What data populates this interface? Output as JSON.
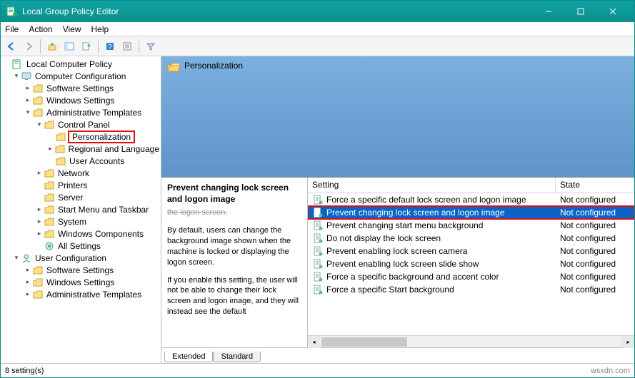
{
  "window": {
    "title": "Local Group Policy Editor"
  },
  "menubar": {
    "file": "File",
    "action": "Action",
    "view": "View",
    "help": "Help"
  },
  "tree": {
    "root": "Local Computer Policy",
    "cc": "Computer Configuration",
    "ss": "Software Settings",
    "ws": "Windows Settings",
    "at": "Administrative Templates",
    "cp": "Control Panel",
    "pers": "Personalization",
    "rl": "Regional and Language",
    "ua": "User Accounts",
    "net": "Network",
    "prn": "Printers",
    "srv": "Server",
    "smt": "Start Menu and Taskbar",
    "sys": "System",
    "wc": "Windows Components",
    "als": "All Settings",
    "uc": "User Configuration",
    "uss": "Software Settings",
    "uws": "Windows Settings",
    "uat": "Administrative Templates"
  },
  "preview": {
    "title": "Personalization"
  },
  "description": {
    "title": "Prevent changing lock screen and logon image",
    "cut": "the logon screen.",
    "p1": "By default, users can change the background image shown when the machine is locked or displaying the logon screen.",
    "p2": "If you enable this setting, the user will not be able to change their lock screen and logon image, and they will instead see the default"
  },
  "grid": {
    "col_setting": "Setting",
    "col_state": "State",
    "rows": [
      {
        "label": "Force a specific default lock screen and logon image",
        "state": "Not configured",
        "selected": false
      },
      {
        "label": "Prevent changing lock screen and logon image",
        "state": "Not configured",
        "selected": true
      },
      {
        "label": "Prevent changing start menu background",
        "state": "Not configured",
        "selected": false
      },
      {
        "label": "Do not display the lock screen",
        "state": "Not configured",
        "selected": false
      },
      {
        "label": "Prevent enabling lock screen camera",
        "state": "Not configured",
        "selected": false
      },
      {
        "label": "Prevent enabling lock screen slide show",
        "state": "Not configured",
        "selected": false
      },
      {
        "label": "Force a specific background and accent color",
        "state": "Not configured",
        "selected": false
      },
      {
        "label": "Force a specific Start background",
        "state": "Not configured",
        "selected": false
      }
    ]
  },
  "tabs": {
    "extended": "Extended",
    "standard": "Standard"
  },
  "status": {
    "left": "8 setting(s)",
    "right": "wsxdn.com"
  }
}
